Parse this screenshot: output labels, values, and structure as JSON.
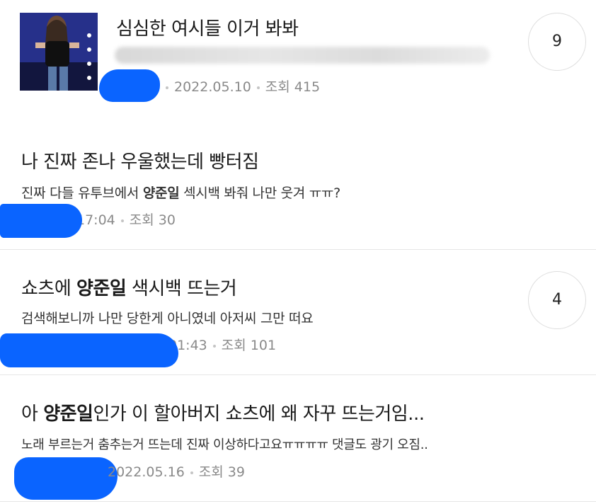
{
  "posts": [
    {
      "title": "심심한 여시들 이거 봐봐",
      "date": "2022.05.10",
      "views": "조회 415",
      "comments": "9"
    },
    {
      "title": "나 진짜 존나 우울했는데 빵터짐",
      "snippet_pre": "진짜 다들 유투브에서 ",
      "keyword": "양준일",
      "snippet_post": " 섹시백 봐줘 나만 웃겨 ㅠㅠ?",
      "time": "17:04",
      "views": "조회 30"
    },
    {
      "title_pre": "쇼츠에 ",
      "keyword": "양준일",
      "title_post": " 색시백 뜨는거",
      "snippet": "검색해보니까 나만 당한게 아니였네 아저씨 그만 떠요",
      "time": "01:43",
      "views": "조회 101",
      "comments": "4"
    },
    {
      "title_pre": "아 ",
      "keyword": "양준일",
      "title_post": "인가 이 할아버지 쇼츠에 왜 자꾸 뜨는거임...",
      "snippet": "노래 부르는거 춤추는거 뜨는데 진짜 이상하다고요ㅠㅠㅠㅠ 댓글도 광기 오짐..",
      "date": "2022.05.16",
      "views": "조회 39"
    }
  ]
}
